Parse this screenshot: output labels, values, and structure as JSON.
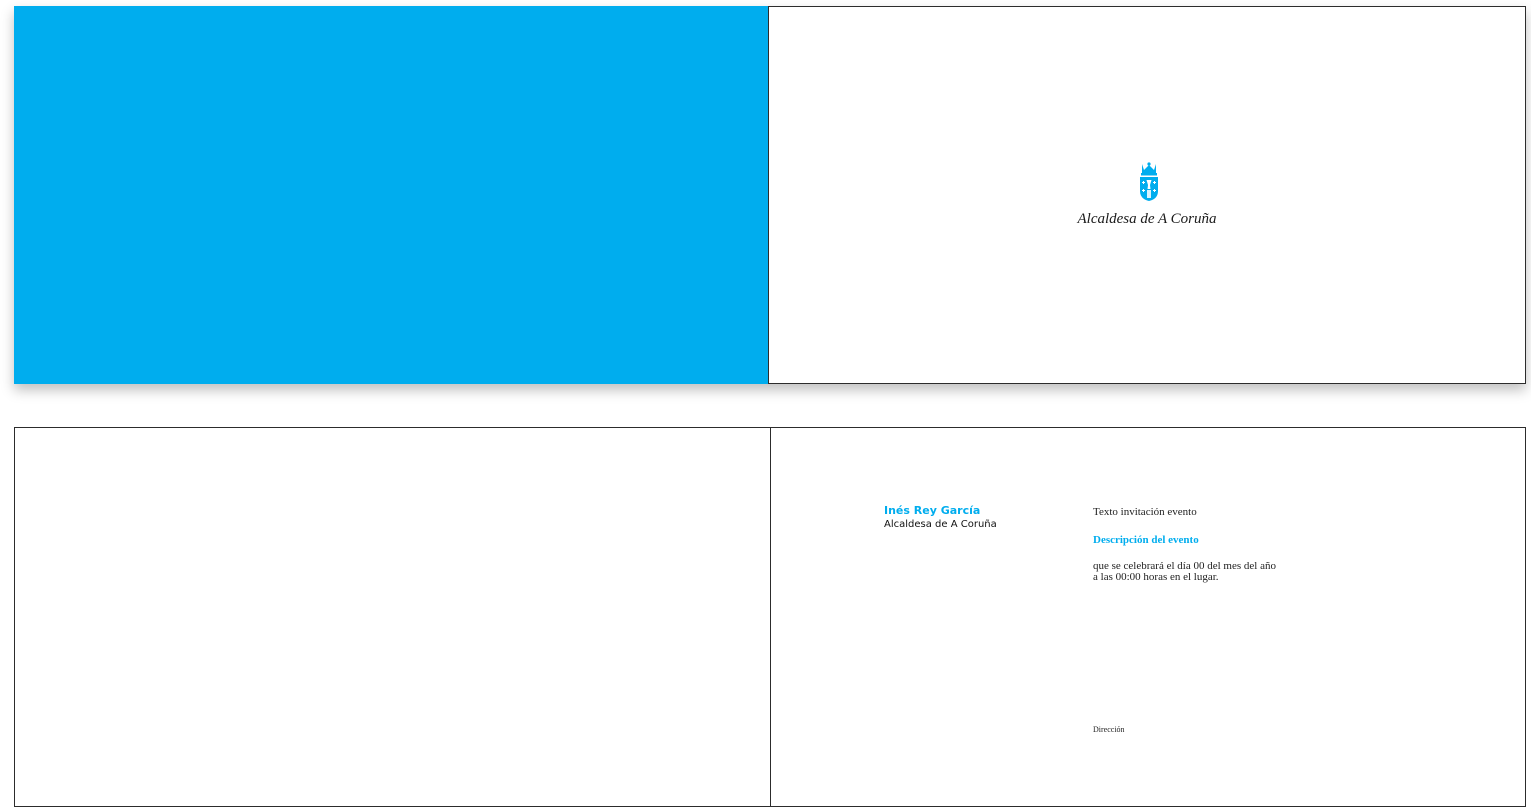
{
  "colors": {
    "brand": "#00adee",
    "border": "#2c2c2c"
  },
  "cover": {
    "crest_icon": "coat-of-arms-icon",
    "title": "Alcaldesa de A Coruña"
  },
  "inside": {
    "sender_name": "Inés Rey García",
    "sender_role": "Alcaldesa de A Coruña",
    "invitation_text": "Texto invitación evento",
    "event_title": "Descripción del evento",
    "event_details": [
      "que se celebrará el día 00 del mes del año",
      "a las 00:00 horas en el lugar."
    ],
    "address": "Dirección"
  }
}
